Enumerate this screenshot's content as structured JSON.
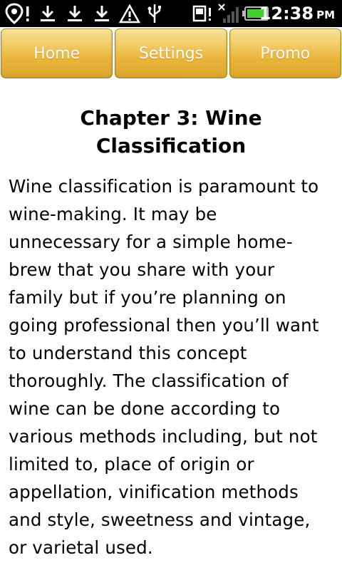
{
  "status_bar": {
    "left_icons": [
      {
        "name": "location-alert-icon",
        "glyph": "⚲!"
      },
      {
        "name": "download-icon",
        "glyph": "⤓"
      },
      {
        "name": "download-icon",
        "glyph": "⤓"
      },
      {
        "name": "download-icon",
        "glyph": "⤓"
      },
      {
        "name": "warning-icon",
        "glyph": "⚠"
      },
      {
        "name": "usb-icon",
        "glyph": "ψ"
      }
    ],
    "right_icons": [
      {
        "name": "sd-card-alert-icon",
        "glyph": "▣!"
      },
      {
        "name": "no-signal-icon",
        "glyph": "✕"
      },
      {
        "name": "battery-icon",
        "glyph": "▬"
      }
    ],
    "time": "12:38",
    "ampm": "PM",
    "battery_color": "#3fcf2f"
  },
  "nav": {
    "home_label": "Home",
    "settings_label": "Settings",
    "promo_label": "Promo"
  },
  "article": {
    "title": "Chapter 3: Wine Classification",
    "body": "Wine classification is paramount to wine-making. It may be unnecessary for a simple home-brew that you share with your family but if you’re planning on going professional then you’ll want to understand this concept thoroughly. The classification of wine can be done according to various methods including, but not limited to, place of origin or appellation, vinification methods and style, sweetness and vintage, or varietal used."
  },
  "colors": {
    "nav_gold": "#e8b43a",
    "status_bar_bg": "#000000"
  }
}
